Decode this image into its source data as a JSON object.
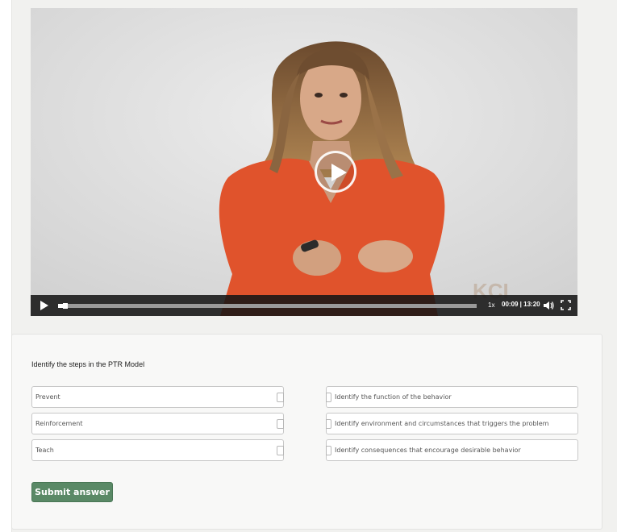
{
  "video": {
    "speed_label": "1x",
    "time_display": "00:09 | 13:20",
    "watermark": "KCI",
    "progress_fraction": 0.0113
  },
  "question": {
    "prompt": "Identify the steps in the PTR Model",
    "left_items": [
      "Prevent",
      "Reinforcement",
      "Teach"
    ],
    "right_items": [
      "Identify the function of the behavior",
      "Identify environment and circumstances that triggers the problem behavior",
      "Identify consequences that encourage desirable behavior"
    ],
    "submit_label": "Submit answer"
  },
  "colors": {
    "submit_button": "#5a8966",
    "shirt": "#e0532c"
  }
}
